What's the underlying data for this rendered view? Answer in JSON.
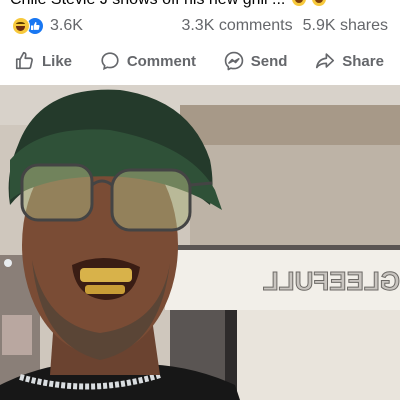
{
  "post": {
    "caption": "Chile Stevie J shows off his new grill ..."
  },
  "stats": {
    "reaction_count": "3.6K",
    "comments": "3.3K comments",
    "shares": "5.9K shares",
    "reaction_icons": [
      "haha-reaction-icon",
      "like-reaction-icon"
    ]
  },
  "actions": [
    {
      "label": "Like",
      "icon": "thumbs-up-icon"
    },
    {
      "label": "Comment",
      "icon": "comment-bubble-icon"
    },
    {
      "label": "Send",
      "icon": "messenger-icon"
    },
    {
      "label": "Share",
      "icon": "share-arrow-icon"
    }
  ],
  "colors": {
    "text_secondary": "#65676b",
    "like_blue": "#1877f2",
    "haha_yellow": "#f7c93c",
    "background": "#ffffff"
  },
  "media": {
    "type": "video",
    "sign_text": "GLEEFULL"
  }
}
